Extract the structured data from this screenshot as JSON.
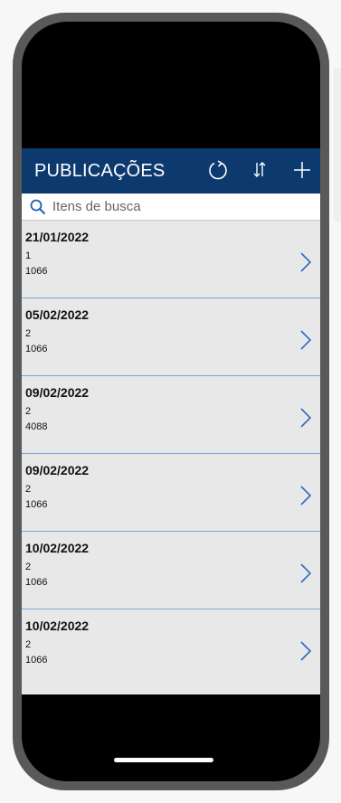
{
  "header": {
    "title": "PUBLICAÇÕES",
    "icons": [
      "refresh-icon",
      "sort-icon",
      "add-icon"
    ]
  },
  "search": {
    "placeholder": "Itens de busca",
    "value": ""
  },
  "items": [
    {
      "date": "21/01/2022",
      "num": "1",
      "code": "1066"
    },
    {
      "date": "05/02/2022",
      "num": "2",
      "code": "1066"
    },
    {
      "date": "09/02/2022",
      "num": "2",
      "code": "4088"
    },
    {
      "date": "09/02/2022",
      "num": "2",
      "code": "1066"
    },
    {
      "date": "10/02/2022",
      "num": "2",
      "code": "1066"
    },
    {
      "date": "10/02/2022",
      "num": "2",
      "code": "1066"
    }
  ],
  "colors": {
    "header_bg": "#0d3a6e",
    "list_bg": "#e8e8e8",
    "divider": "#7aa6d9",
    "chevron": "#2b6cc4",
    "phone_frame": "#595959"
  }
}
